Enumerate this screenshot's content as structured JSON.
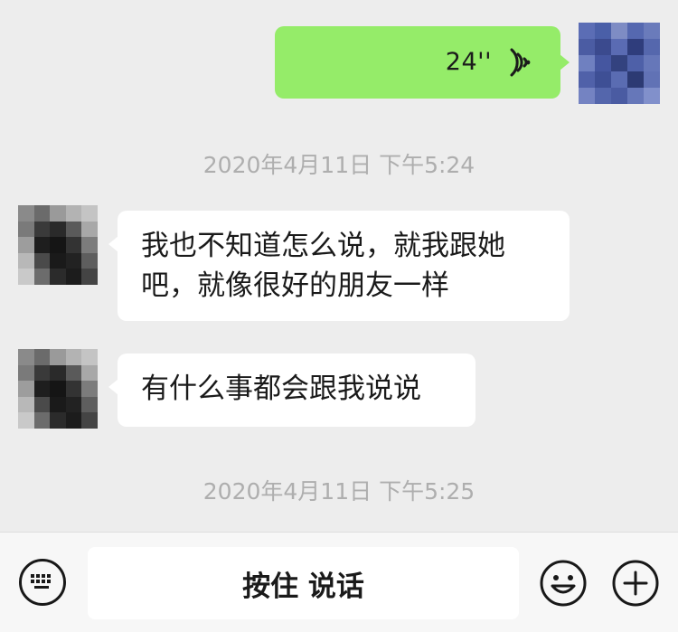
{
  "chat": {
    "messages": [
      {
        "sender": "self",
        "type": "voice",
        "duration": "24''",
        "icon": "voice-wave-icon"
      },
      {
        "type": "timestamp",
        "text": "2020年4月11日 下午5:24"
      },
      {
        "sender": "other",
        "type": "text",
        "lines": [
          "我也不知道怎么说，就我跟她",
          "吧，就像很好的朋友一样"
        ]
      },
      {
        "sender": "other",
        "type": "text",
        "lines": [
          "有什么事都会跟我说说"
        ]
      },
      {
        "type": "timestamp",
        "text": "2020年4月11日 下午5:25"
      }
    ]
  },
  "input_bar": {
    "keyboard_icon": "keyboard-icon",
    "hold_to_talk_label": "按住 说话",
    "emoji_icon": "emoji-icon",
    "more_icon": "plus-icon"
  },
  "colors": {
    "sent_bubble": "#95ec69",
    "received_bubble": "#ffffff",
    "background": "#ededed",
    "timestamp_text": "#aeaeae"
  }
}
